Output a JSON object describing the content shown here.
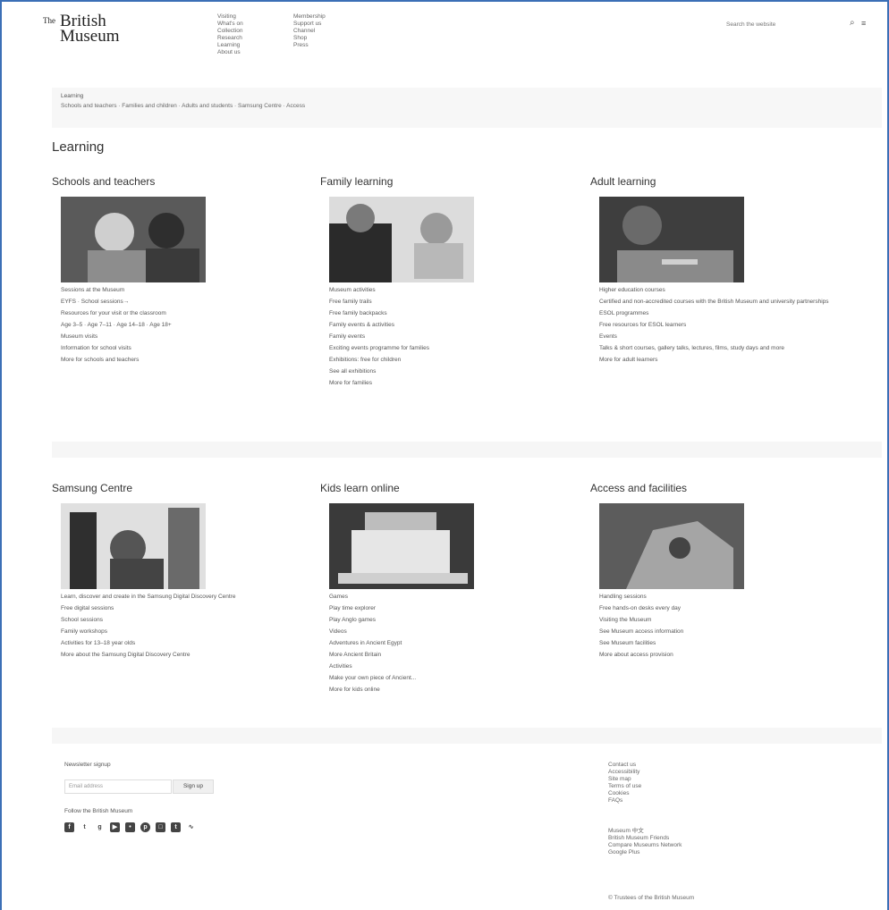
{
  "header": {
    "logo_the": "The",
    "logo_line1": "British",
    "logo_line2": "Museum",
    "nav_col1": [
      "Visiting",
      "What's on",
      "Collection",
      "Research",
      "Learning",
      "About us"
    ],
    "nav_col2": [
      "Membership",
      "Support us",
      "Channel",
      "Shop",
      "Press"
    ],
    "search_placeholder": "Search the website"
  },
  "breadcrumb": {
    "top": "Learning",
    "links": "Schools and teachers · Families and children · Adults and students · Samsung Centre · Access"
  },
  "page_title": "Learning",
  "sections": [
    {
      "title": "Schools and teachers",
      "links": [
        "Sessions at the Museum",
        "EYFS · School sessions→",
        "Resources for your visit or the classroom",
        "Age 3–5 · Age 7–11 · Age 14–18 · Age 18+",
        "Museum visits",
        "Information for school visits",
        "More for schools and teachers"
      ]
    },
    {
      "title": "Family learning",
      "links": [
        "Museum activities",
        "Free family trails",
        "Free family backpacks",
        "Family events & activities",
        "Family events",
        "Exciting events programme for families",
        "Exhibitions: free for children",
        "See all exhibitions",
        "More for families"
      ]
    },
    {
      "title": "Adult learning",
      "links": [
        "Higher education courses",
        "Certified and non-accredited courses with the British Museum and university partnerships",
        "ESOL programmes",
        "Free resources for ESOL learners",
        "Events",
        "Talks & short courses, gallery talks, lectures, films, study days and more",
        "More for adult learners"
      ]
    },
    {
      "title": "Samsung Centre",
      "links": [
        "Learn, discover and create in the Samsung Digital Discovery Centre",
        "Free digital sessions",
        "School sessions",
        "Family workshops",
        "Activities for 13–18 year olds",
        "More about the Samsung Digital Discovery Centre"
      ]
    },
    {
      "title": "Kids learn online",
      "links": [
        "Games",
        "Play time explorer",
        "Play Anglo games",
        "Videos",
        "Adventures in Ancient Egypt",
        "More Ancient Britain",
        "Activities",
        "Make your own piece of Ancient...",
        "More for kids online"
      ]
    },
    {
      "title": "Access and facilities",
      "links": [
        "Handling sessions",
        "Free hands-on desks every day",
        "Visiting the Museum",
        "See Museum access information",
        "See Museum facilities",
        "More about access provision"
      ]
    }
  ],
  "footer": {
    "newsletter_label": "Newsletter signup",
    "newsletter_placeholder": "Email address",
    "signup_label": "Sign up",
    "follow_label": "Follow the British Museum",
    "social_icons": [
      "facebook-icon",
      "twitter-icon",
      "google-plus-icon",
      "youtube-icon",
      "flickr-icon",
      "pinterest-icon",
      "instagram-icon",
      "tumblr-icon",
      "rss-icon"
    ],
    "links_col1": [
      "Contact us",
      "Accessibility",
      "Site map",
      "Terms of use",
      "Cookies",
      "FAQs"
    ],
    "links_col2": [
      "Museum 中文",
      "British Museum Friends",
      "Compare Museums Network",
      "Google Plus"
    ],
    "copyright": "© Trustees of the British Museum"
  }
}
